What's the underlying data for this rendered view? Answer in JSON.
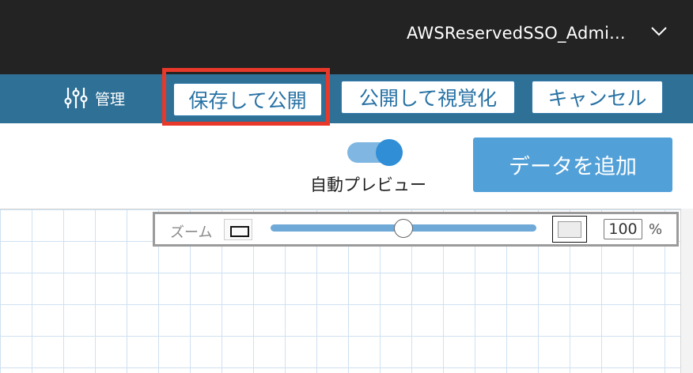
{
  "header": {
    "account_name": "AWSReservedSSO_Admi...",
    "account_menu_icon": "chevron-down-icon"
  },
  "toolbar": {
    "manage_icon": "sliders-icon",
    "manage_label": "管理",
    "save_publish_label": "保存して公開",
    "publish_visualize_label": "公開して視覚化",
    "cancel_label": "キャンセル",
    "highlight_color": "#e8382a"
  },
  "preview": {
    "label": "自動プレビュー",
    "enabled": true
  },
  "actions": {
    "add_data_label": "データを追加"
  },
  "zoom": {
    "label": "ズーム",
    "value": "100",
    "unit": "%",
    "zoom_out_icon": "small-rectangle-icon",
    "zoom_in_icon": "large-rectangle-icon"
  },
  "colors": {
    "topbar": "#232323",
    "toolbar": "#2f7096",
    "accent": "#52a0d8",
    "button_text": "#2872a4"
  }
}
